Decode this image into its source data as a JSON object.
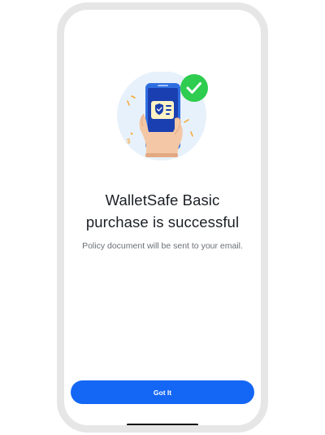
{
  "screen": {
    "title_line1": "WalletSafe Basic",
    "title_line2": "purchase is successful",
    "subtitle": "Policy document will be sent to your email."
  },
  "actions": {
    "primary_label": "Got It"
  },
  "illustration": {
    "name": "phone-success-illustration",
    "icons": [
      "shield-card-icon",
      "checkmark-badge-icon",
      "dollar-icon"
    ]
  },
  "colors": {
    "accent": "#1467f5",
    "success": "#2ecc4f",
    "illustration_bg": "#e7f1fb",
    "phone_screen": "#1a3fb0",
    "title_text": "#1b1f24",
    "subtitle_text": "#6b6f76"
  }
}
